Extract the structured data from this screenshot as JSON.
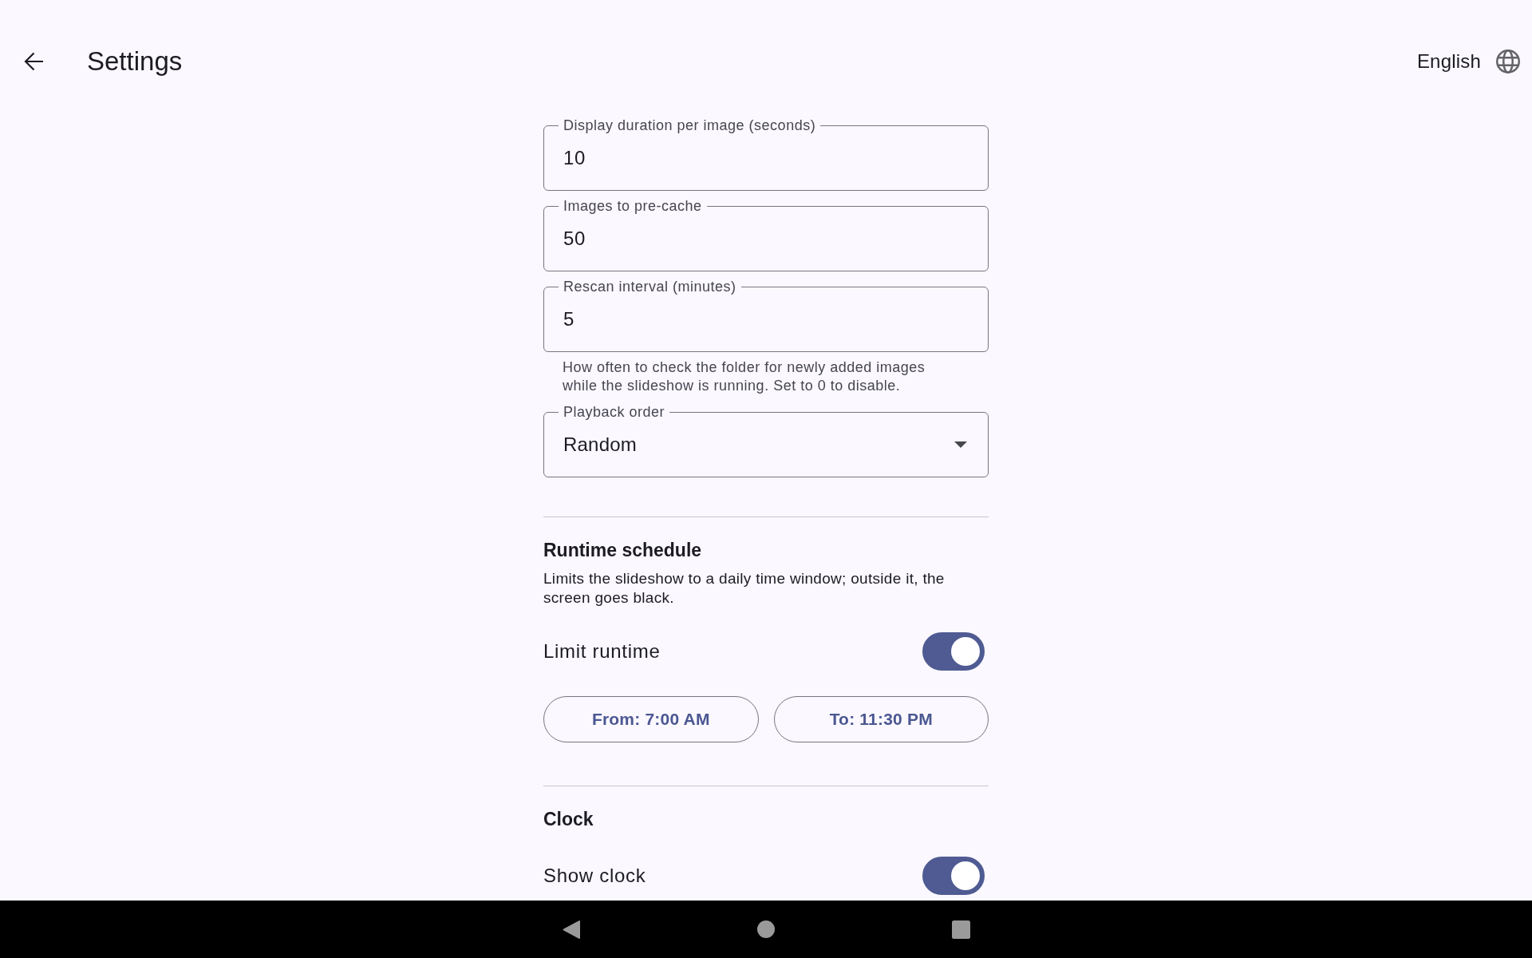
{
  "app_bar": {
    "title": "Settings",
    "language": "English"
  },
  "fields": [
    {
      "kind": "text",
      "label": "Display duration per image (seconds)",
      "value": "10"
    },
    {
      "kind": "text",
      "label": "Images to pre-cache",
      "value": "50"
    },
    {
      "kind": "text",
      "label": "Rescan interval (minutes)",
      "value": "5",
      "helper": "How often to check the folder for newly added images while the slideshow is running. Set to 0 to disable."
    },
    {
      "kind": "dropdown",
      "label": "Playback order",
      "value": "Random"
    }
  ],
  "sections": [
    {
      "title": "Runtime schedule",
      "description": "Limits the slideshow to a daily time window; outside it, the screen goes black.",
      "switches": [
        {
          "label": "Limit runtime",
          "on": true
        }
      ],
      "buttons": [
        "From: 7:00 AM",
        "To: 11:30 PM"
      ]
    },
    {
      "title": "Clock",
      "switches": [
        {
          "label": "Show clock",
          "on": true
        }
      ]
    }
  ]
}
